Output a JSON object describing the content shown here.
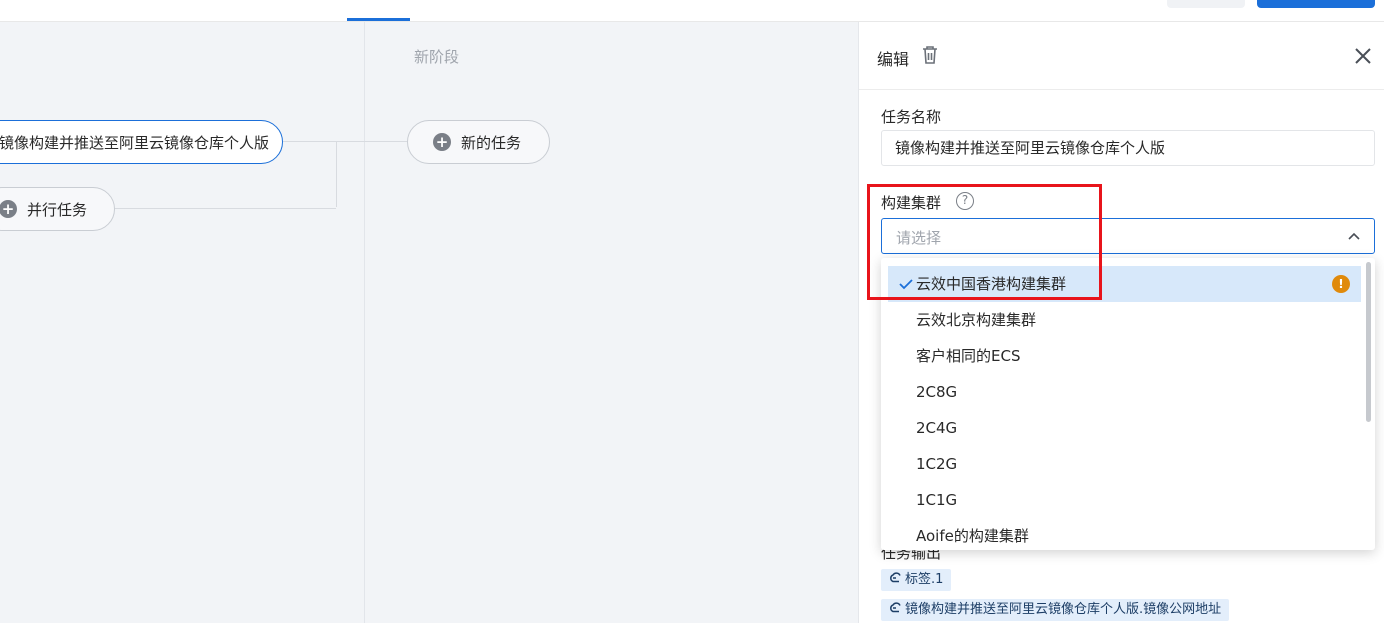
{
  "canvas": {
    "stage_title": "新阶段",
    "nodes": {
      "selected_task": "镜像构建并推送至阿里云镜像仓库个人版",
      "parallel_task": "并行任务",
      "new_task": "新的任务"
    }
  },
  "panel": {
    "title": "编辑",
    "task_name_label": "任务名称",
    "task_name_value": "镜像构建并推送至阿里云镜像仓库个人版",
    "cluster_label": "构建集群",
    "cluster_placeholder": "请选择",
    "help_glyph": "?",
    "output_label": "任务输出",
    "output_tags": [
      "标签.1",
      "镜像构建并推送至阿里云镜像仓库个人版.镜像公网地址"
    ]
  },
  "dropdown": {
    "options": [
      "云效中国香港构建集群",
      "云效北京构建集群",
      "客户相同的ECS",
      "2C8G",
      "2C4G",
      "1C2G",
      "1C1G",
      "Aoife的构建集群"
    ],
    "selected_index": 0,
    "warning_glyph": "!"
  },
  "colors": {
    "accent": "#1b6fd9",
    "highlight": "#e8141b",
    "warning": "#e08a0b",
    "selected_option_bg": "#d7e8fa"
  }
}
